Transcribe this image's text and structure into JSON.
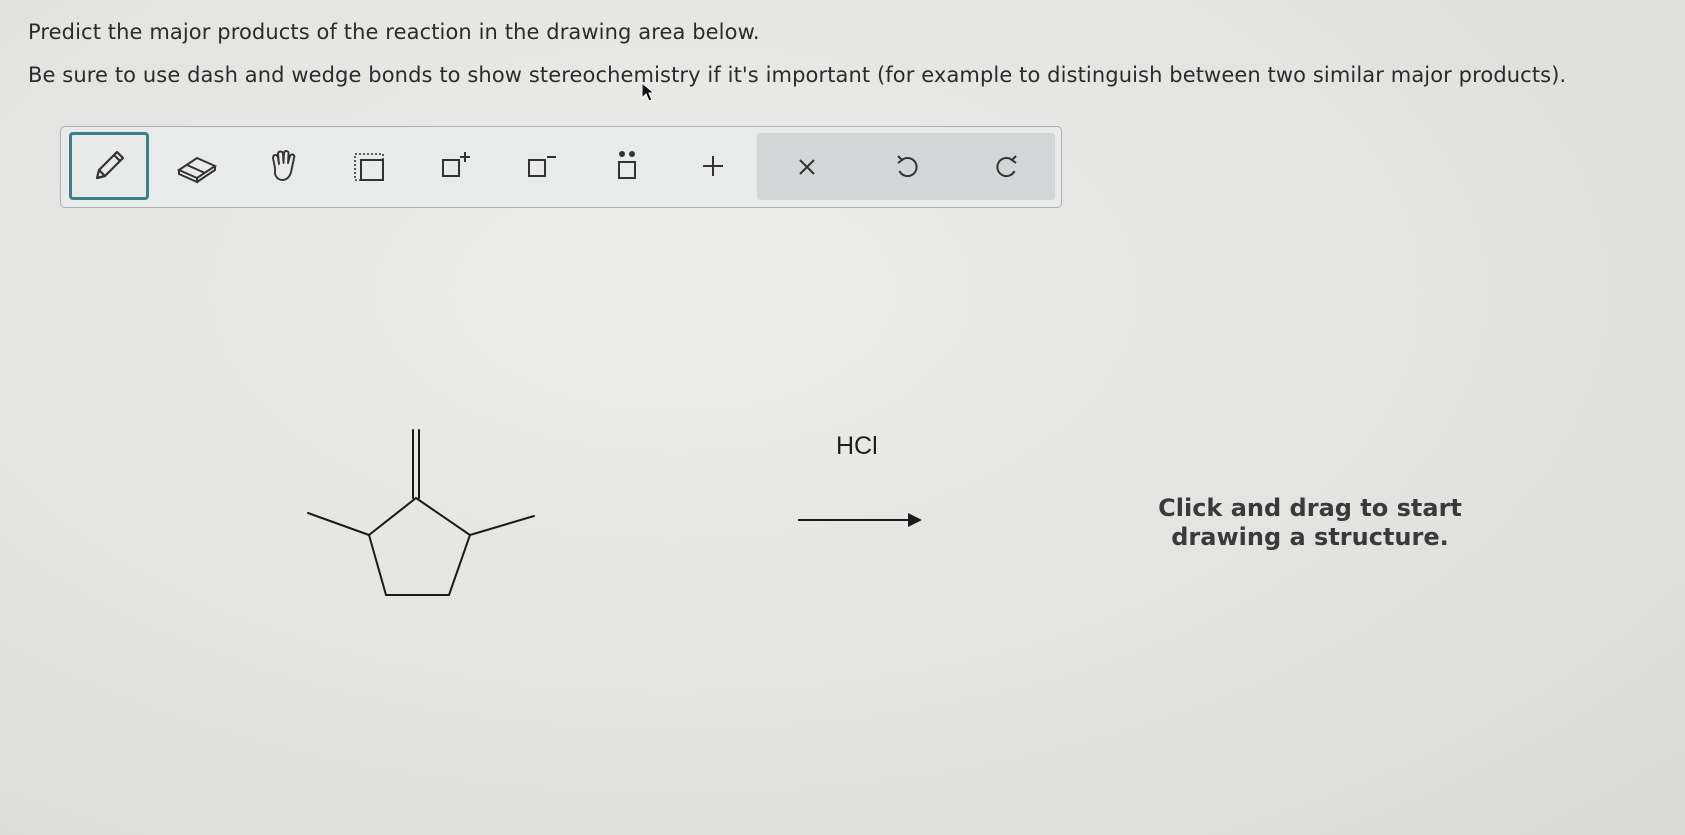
{
  "instructions": {
    "line1": "Predict the major products of the reaction in the drawing area below.",
    "line2": "Be sure to use dash and wedge bonds to show stereochemistry if it's important (for example to distinguish between two similar major products)."
  },
  "toolbar": {
    "tools": [
      {
        "name": "pencil-icon",
        "selected": true
      },
      {
        "name": "eraser-icon",
        "selected": false
      },
      {
        "name": "hand-icon",
        "selected": false
      },
      {
        "name": "select-box-icon",
        "selected": false
      },
      {
        "name": "positive-charge-icon",
        "selected": false
      },
      {
        "name": "negative-charge-icon",
        "selected": false
      },
      {
        "name": "lone-pair-icon",
        "selected": false
      },
      {
        "name": "plus-icon",
        "selected": false
      }
    ],
    "actions": [
      {
        "name": "clear-icon"
      },
      {
        "name": "undo-icon"
      },
      {
        "name": "redo-icon"
      }
    ],
    "accent_color": "#3d7f86"
  },
  "reaction": {
    "reagent": "HCl",
    "reactant": "1,3-dimethyl-2-methylenecyclopentane"
  },
  "canvas": {
    "hint_line1": "Click and drag to start",
    "hint_line2": "drawing a structure."
  }
}
